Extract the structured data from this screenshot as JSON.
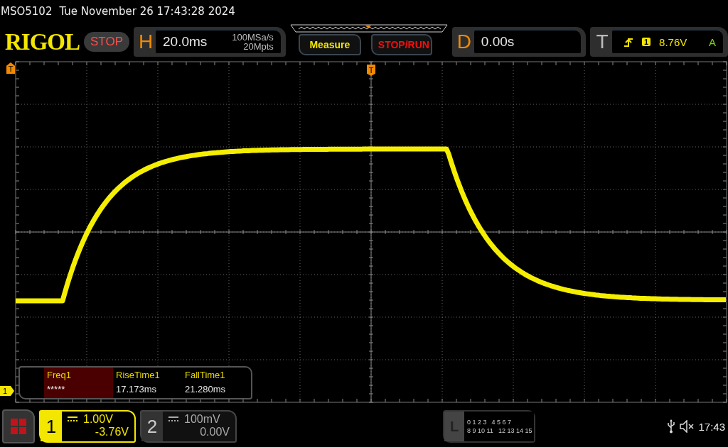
{
  "status_line": {
    "model": "MSO5102",
    "datetime": "Tue November 26 17:43:28 2024"
  },
  "header": {
    "logo": "RIGOL",
    "run_state": "STOP",
    "horizontal": {
      "label": "H",
      "timebase": "20.0ms",
      "sample_rate": "100MSa/s",
      "memory_depth": "20Mpts"
    },
    "measure_button": "Measure",
    "stop_run_button": "STOP/RUN",
    "delay": {
      "label": "D",
      "value": "0.00s"
    },
    "trigger": {
      "label": "T",
      "source": "1",
      "level": "8.76V",
      "mode": "A"
    }
  },
  "screen": {
    "trigger_level_marker": "T",
    "trigger_position_marker": "T",
    "channel_marker": "1"
  },
  "measurements": [
    {
      "name": "Freq1",
      "value": "*****",
      "selected": true
    },
    {
      "name": "RiseTime1",
      "value": "17.173ms",
      "selected": false
    },
    {
      "name": "FallTime1",
      "value": "21.280ms",
      "selected": false
    }
  ],
  "channels": [
    {
      "number": "1",
      "scale": "1.00V",
      "offset": "-3.76V",
      "active": true
    },
    {
      "number": "2",
      "scale": "100mV",
      "offset": "0.00V",
      "active": false
    }
  ],
  "logic": {
    "label": "L",
    "rows": [
      [
        "0 1 2 3",
        "4 5 6 7"
      ],
      [
        "8 9 10 11",
        "12 13 14 15"
      ]
    ]
  },
  "status": {
    "time": "17:43"
  }
}
